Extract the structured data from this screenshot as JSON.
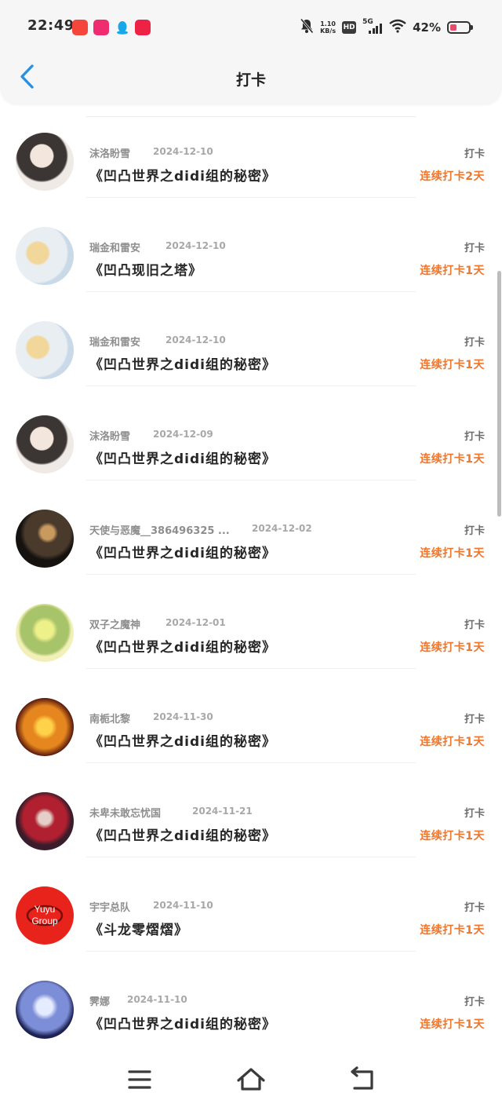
{
  "status_bar": {
    "time": "22:49",
    "net_speed_value": "1.10",
    "net_speed_unit": "KB/s",
    "hd": "HD",
    "network": "5G",
    "battery": "42%"
  },
  "header": {
    "title": "打卡"
  },
  "entries": [
    {
      "name": "沫洛盼雪",
      "date": "2024-12-10",
      "book": "《凹凸世界之didi组的秘密》",
      "checkin": "打卡",
      "streak": "连续打卡2天"
    },
    {
      "name": "瑞金和雷安",
      "date": "2024-12-10",
      "book": "《凹凸现旧之塔》",
      "checkin": "打卡",
      "streak": "连续打卡1天"
    },
    {
      "name": "瑞金和雷安",
      "date": "2024-12-10",
      "book": "《凹凸世界之didi组的秘密》",
      "checkin": "打卡",
      "streak": "连续打卡1天"
    },
    {
      "name": "沫洛盼雪",
      "date": "2024-12-09",
      "book": "《凹凸世界之didi组的秘密》",
      "checkin": "打卡",
      "streak": "连续打卡1天"
    },
    {
      "name": "天使与恶魔__386496325 ...",
      "date": "2024-12-02",
      "book": "《凹凸世界之didi组的秘密》",
      "checkin": "打卡",
      "streak": "连续打卡1天"
    },
    {
      "name": "双子之魔神",
      "date": "2024-12-01",
      "book": "《凹凸世界之didi组的秘密》",
      "checkin": "打卡",
      "streak": "连续打卡1天"
    },
    {
      "name": "南栀北黎",
      "date": "2024-11-30",
      "book": "《凹凸世界之didi组的秘密》",
      "checkin": "打卡",
      "streak": "连续打卡1天"
    },
    {
      "name": "未卑未敢忘忧国",
      "date": "2024-11-21",
      "book": "《凹凸世界之didi组的秘密》",
      "checkin": "打卡",
      "streak": "连续打卡1天"
    },
    {
      "name": "宇宇总队",
      "date": "2024-11-10",
      "book": "《斗龙零熠熠》",
      "checkin": "打卡",
      "streak": "连续打卡1天",
      "avatar_text": "Yuyu Group"
    },
    {
      "name": "霁娜",
      "date": "2024-11-10",
      "book": "《凹凸世界之didi组的秘密》",
      "checkin": "打卡",
      "streak": "连续打卡1天"
    }
  ],
  "colors": {
    "accent": "#2b8fe0",
    "streak": "#f0762b",
    "background": "#ffffff",
    "header_bg": "#f6f6f7"
  },
  "icons": {
    "back": "chevron-left-icon",
    "menu": "menu-icon",
    "home": "home-icon",
    "return": "return-icon"
  }
}
